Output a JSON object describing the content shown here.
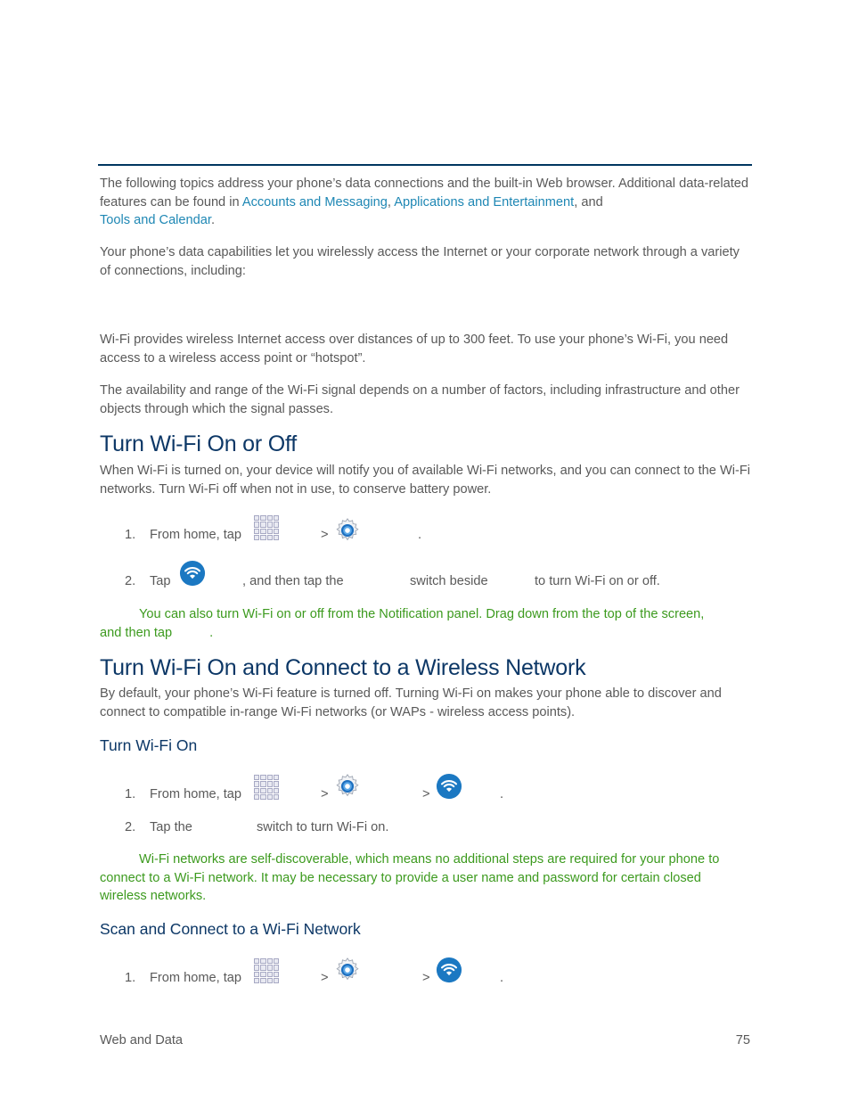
{
  "intro": {
    "p1_text_a": "The following topics address your phone’s data connections and the built-in Web browser. Additional data-related features can be found in ",
    "p1_link_1": "Accounts and Messaging",
    "p1_sep_1": ", ",
    "p1_link_2": "Applications and Entertainment",
    "p1_sep_2": ", and",
    "p1_link_3": "Tools and Calendar",
    "p1_end": ".",
    "p2": "Your phone’s data capabilities let you wirelessly access the Internet or your corporate network through a variety of connections, including:"
  },
  "wifi": {
    "p1": "Wi-Fi provides wireless Internet access over distances of up to 300 feet. To use your phone’s Wi-Fi, you need access to a wireless access point or “hotspot”.",
    "p2": "The availability and range of the Wi-Fi signal depends on a number of factors, including infrastructure and other objects through which the signal passes."
  },
  "section_on_off": {
    "heading": "Turn Wi-Fi On or Off",
    "desc": "When Wi-Fi is turned on, your device will notify you of available Wi-Fi networks, and you can connect to the Wi-Fi networks. Turn Wi-Fi off when not in use, to conserve battery power.",
    "steps": [
      {
        "num": "1.",
        "text_a": "From home, tap",
        "sep_1": ">",
        "end": "."
      },
      {
        "num": "2.",
        "text_a": "Tap",
        "text_b": ", and then tap the",
        "text_c": "switch beside",
        "text_d": "to turn Wi-Fi on or off."
      }
    ],
    "note_line1": "You can also turn Wi-Fi on or off from the Notification panel. Drag down from the top of the screen,",
    "note_line2": "and then tap",
    "note_end": "."
  },
  "section_connect": {
    "heading": "Turn Wi-Fi On and Connect to a Wireless Network",
    "desc": "By default, your phone’s Wi-Fi feature is turned off. Turning Wi-Fi on makes your phone able to discover and connect to compatible in-range Wi-Fi networks (or WAPs - wireless access points).",
    "sub_turn_on": {
      "heading": "Turn Wi-Fi On",
      "steps": [
        {
          "num": "1.",
          "text_a": "From home, tap",
          "sep_1": ">",
          "sep_2": ">",
          "end": "."
        },
        {
          "num": "2.",
          "text_a": "Tap the",
          "text_b": "switch to turn Wi-Fi on."
        }
      ],
      "note": "Wi-Fi networks are self-discoverable, which means no additional steps are required for your phone to connect to a Wi-Fi network. It may be necessary to provide a user name and password for certain closed wireless networks."
    },
    "sub_scan": {
      "heading": "Scan and Connect to a Wi-Fi Network",
      "steps": [
        {
          "num": "1.",
          "text_a": "From home, tap",
          "sep_1": ">",
          "sep_2": ">",
          "end": "."
        }
      ]
    }
  },
  "icons": {
    "apps": "apps-grid-icon",
    "settings": "settings-gear-icon",
    "wifi": "wifi-icon"
  },
  "colors": {
    "heading": "#0c3766",
    "link": "#1e87b4",
    "note": "#3c9a1e",
    "body_text": "#595959",
    "rule": "#003660",
    "wifi_icon": "#1b78c2"
  },
  "footer": {
    "section": "Web and Data",
    "page_number": "75"
  }
}
